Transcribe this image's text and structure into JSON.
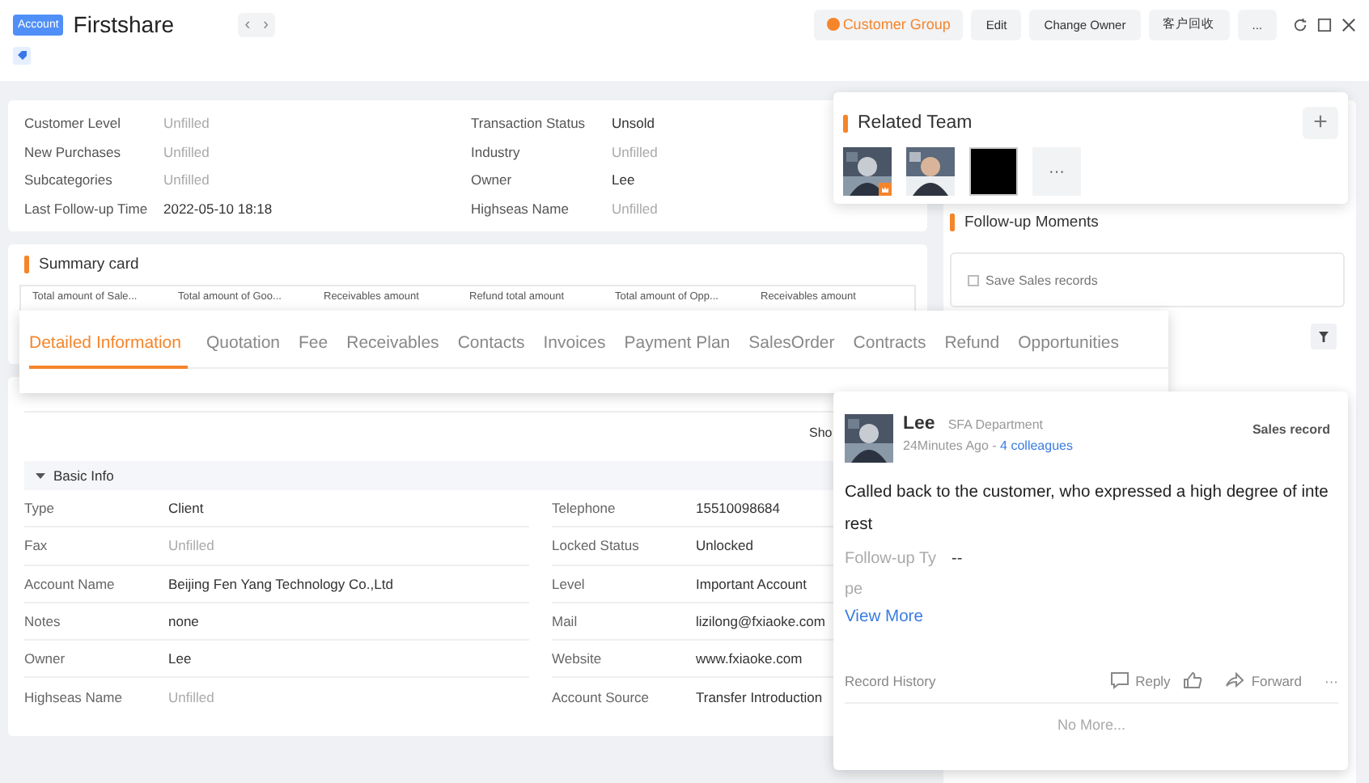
{
  "header": {
    "badge": "Account",
    "title": "Firstshare",
    "nav": [
      "‹",
      "›"
    ],
    "actions": [
      {
        "label": "Customer Group",
        "kind": "accent"
      },
      {
        "label": "Edit",
        "kind": "plain"
      },
      {
        "label": "Change Owner",
        "kind": "plain"
      },
      {
        "label": "客户回收",
        "kind": "plain"
      },
      {
        "label": "...",
        "kind": "plain"
      }
    ]
  },
  "overview": [
    {
      "label": "Customer Level",
      "value": "Unfilled",
      "empty": true
    },
    {
      "label": "Transaction Status",
      "value": "Unsold",
      "empty": false
    },
    {
      "label": "New Purchases",
      "value": "Unfilled",
      "empty": true
    },
    {
      "label": "Industry",
      "value": "Unfilled",
      "empty": true
    },
    {
      "label": "Subcategories",
      "value": "Unfilled",
      "empty": true
    },
    {
      "label": "Owner",
      "value": "Lee",
      "empty": false
    },
    {
      "label": "Last Follow-up Time",
      "value": "2022-05-10 18:18",
      "empty": false
    },
    {
      "label": "Highseas Name",
      "value": "Unfilled",
      "empty": true
    }
  ],
  "summary_card": {
    "title": "Summary card",
    "columns": [
      "Total amount of Sale...",
      "Total amount of Goo...",
      "Receivables amount",
      "Refund total amount",
      "Total amount of Opp...",
      "Receivables amount"
    ]
  },
  "tabs_popup": [
    {
      "label": "Detailed Information",
      "selected": true
    },
    {
      "label": "Quotation",
      "selected": false
    },
    {
      "label": "Fee",
      "selected": false
    },
    {
      "label": "Receivables",
      "selected": false
    },
    {
      "label": "Contacts",
      "selected": false
    },
    {
      "label": "Invoices",
      "selected": false
    },
    {
      "label": "Payment Plan",
      "selected": false
    },
    {
      "label": "SalesOrder",
      "selected": false
    },
    {
      "label": "Contracts",
      "selected": false
    },
    {
      "label": "Refund",
      "selected": false
    },
    {
      "label": "Opportunities",
      "selected": false
    }
  ],
  "detail": {
    "show_text": "Sho",
    "section": {
      "title": "Basic Info",
      "expanded": true
    },
    "fields": [
      {
        "label": "Type",
        "value": "Client",
        "empty": false
      },
      {
        "label": "Telephone",
        "value": "15510098684",
        "empty": false
      },
      {
        "label": "Fax",
        "value": "Unfilled",
        "empty": true
      },
      {
        "label": "Locked Status",
        "value": "Unlocked",
        "empty": false
      },
      {
        "label": "Account Name",
        "value": "Beijing Fen Yang Technology Co.,Ltd",
        "empty": false
      },
      {
        "label": "Level",
        "value": "Important Account",
        "empty": false
      },
      {
        "label": "Notes",
        "value": "none",
        "empty": false
      },
      {
        "label": "Mail",
        "value": "lizilong@fxiaoke.com",
        "empty": false
      },
      {
        "label": "Owner",
        "value": "Lee",
        "empty": false
      },
      {
        "label": "Website",
        "value": "www.fxiaoke.com",
        "empty": false
      },
      {
        "label": "Highseas Name",
        "value": "Unfilled",
        "empty": true
      },
      {
        "label": "Account Source",
        "value": "Transfer Introduction",
        "empty": false
      }
    ]
  },
  "related_team": {
    "title": "Related Team",
    "add": "+",
    "members": [
      {
        "kind": "picture",
        "owner": true
      },
      {
        "kind": "picture",
        "owner": false
      },
      {
        "kind": "blank",
        "owner": false
      }
    ],
    "more": "···"
  },
  "follow_up": {
    "title": "Follow-up Moments",
    "prompt": "Save Sales records"
  },
  "feed": {
    "author": "Lee",
    "department": "SFA Department",
    "time": "24Minutes Ago - ",
    "colleagues": "4 colleagues",
    "type": "Sales record",
    "body": "Called back to the customer, who expressed a high degree of interest",
    "field_label": "Follow-up Type",
    "field_value": "--",
    "view_more": "View More",
    "history": "Record History",
    "reply": "Reply",
    "forward": "Forward",
    "more": "···",
    "end": "No More..."
  }
}
